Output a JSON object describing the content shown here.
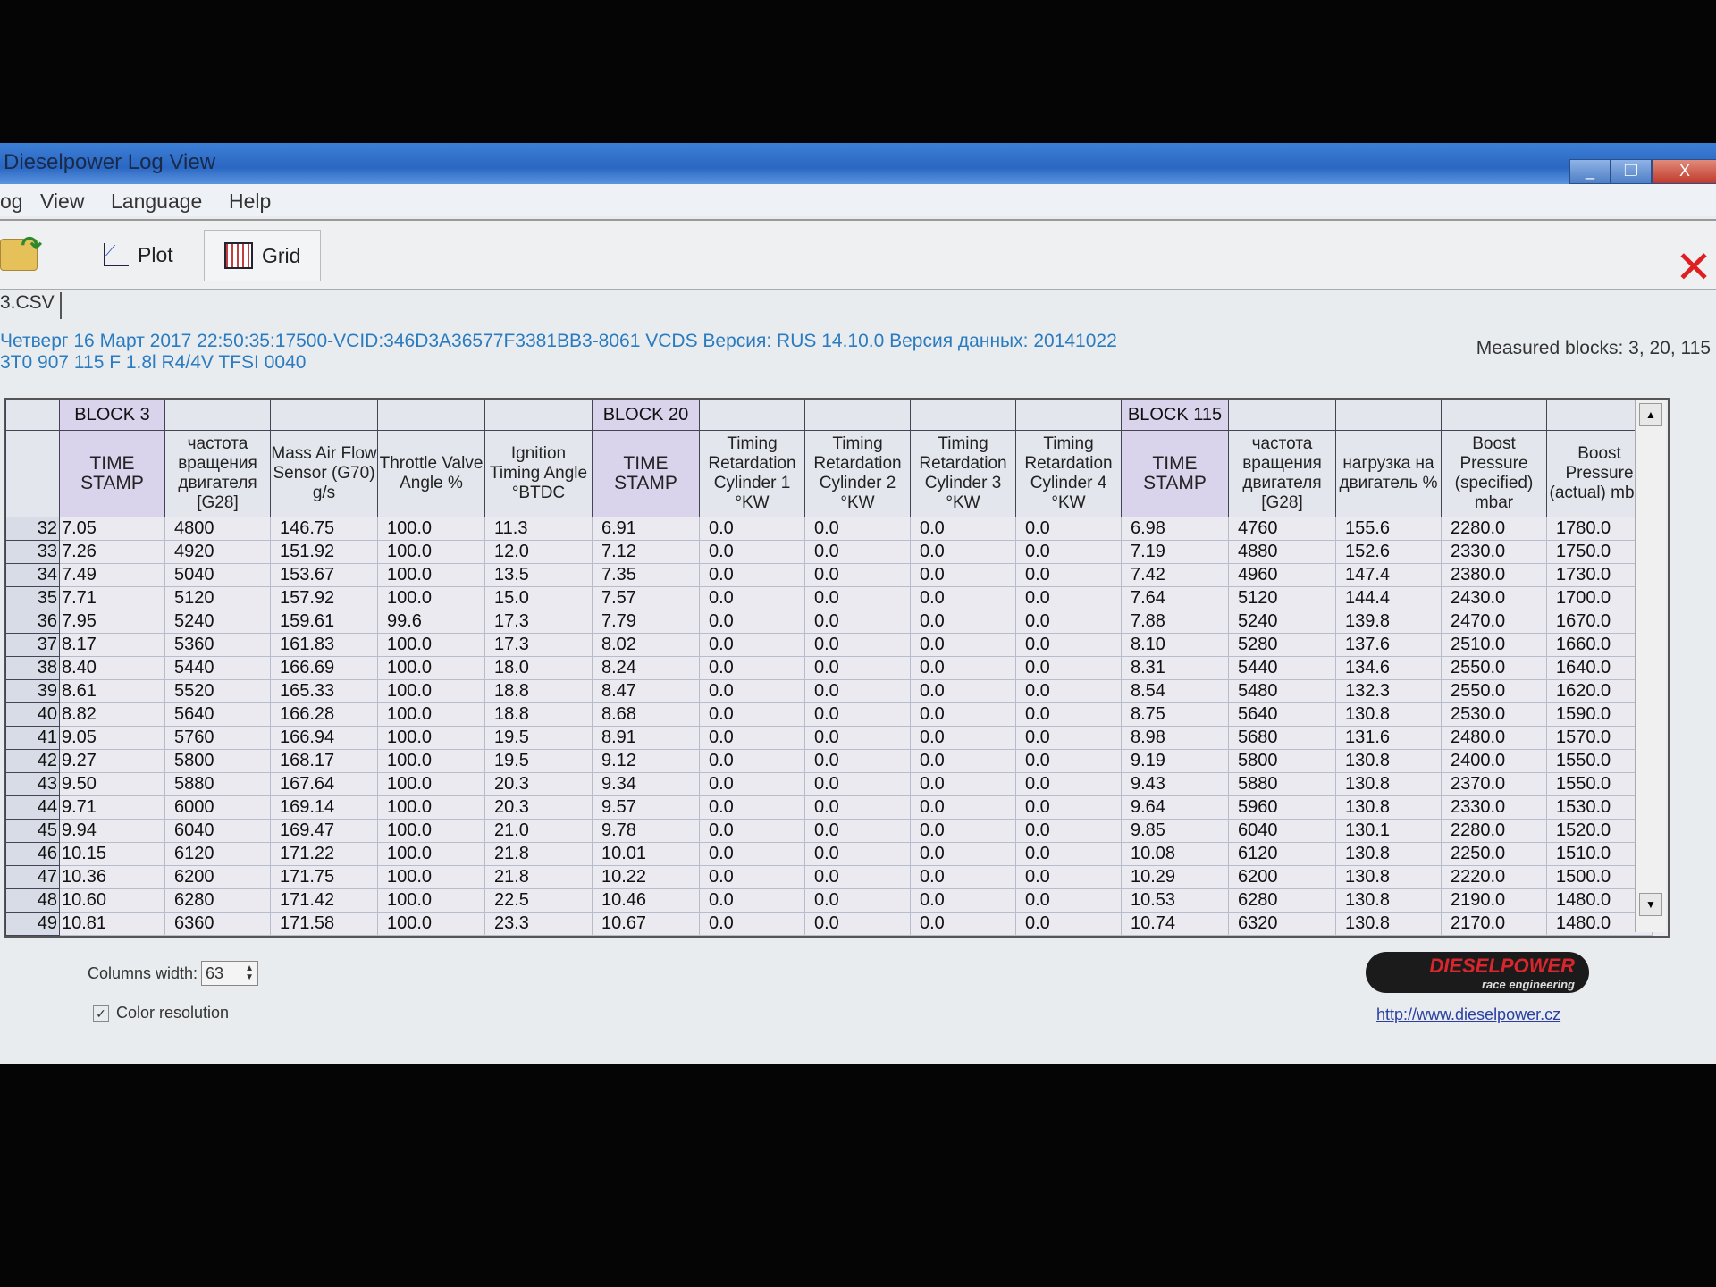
{
  "window": {
    "title": "Dieselpower Log View",
    "minimize": "_",
    "restore": "❐",
    "close": "X"
  },
  "menu": [
    "og",
    "View",
    "Language",
    "Help"
  ],
  "toolbar": {
    "plot": "Plot",
    "grid": "Grid",
    "close_icon": "✕"
  },
  "tab": {
    "label": "3.CSV"
  },
  "info": {
    "line1": "Четверг 16 Март 2017 22:50:35:17500-VCID:346D3A36577F3381BB3-8061 VCDS Версия: RUS 14.10.0 Версия данных: 20141022",
    "line2": "3T0 907 115 F  1.8l R4/4V TFSI     0040",
    "measured": "Measured blocks: 3, 20, 115"
  },
  "blocks": [
    "BLOCK 3",
    "BLOCK 20",
    "BLOCK 115"
  ],
  "columns": [
    "TIME STAMP",
    "частота вращения двигателя [G28]",
    "Mass Air Flow Sensor (G70) g/s",
    "Throttle Valve Angle %",
    "Ignition Timing Angle °BTDC",
    "TIME STAMP",
    "Timing Retardation Cylinder 1 °KW",
    "Timing Retardation Cylinder 2 °KW",
    "Timing Retardation Cylinder 3 °KW",
    "Timing Retardation Cylinder 4 °KW",
    "TIME STAMP",
    "частота вращения двигателя [G28]",
    "нагрузка на двигатель %",
    "Boost Pressure (specified) mbar",
    "Boost Pressure (actual) mbar"
  ],
  "rows": [
    [
      "32",
      "7.05",
      "4800",
      "146.75",
      "100.0",
      "11.3",
      "6.91",
      "0.0",
      "0.0",
      "0.0",
      "0.0",
      "6.98",
      "4760",
      "155.6",
      "2280.0",
      "1780.0"
    ],
    [
      "33",
      "7.26",
      "4920",
      "151.92",
      "100.0",
      "12.0",
      "7.12",
      "0.0",
      "0.0",
      "0.0",
      "0.0",
      "7.19",
      "4880",
      "152.6",
      "2330.0",
      "1750.0"
    ],
    [
      "34",
      "7.49",
      "5040",
      "153.67",
      "100.0",
      "13.5",
      "7.35",
      "0.0",
      "0.0",
      "0.0",
      "0.0",
      "7.42",
      "4960",
      "147.4",
      "2380.0",
      "1730.0"
    ],
    [
      "35",
      "7.71",
      "5120",
      "157.92",
      "100.0",
      "15.0",
      "7.57",
      "0.0",
      "0.0",
      "0.0",
      "0.0",
      "7.64",
      "5120",
      "144.4",
      "2430.0",
      "1700.0"
    ],
    [
      "36",
      "7.95",
      "5240",
      "159.61",
      "99.6",
      "17.3",
      "7.79",
      "0.0",
      "0.0",
      "0.0",
      "0.0",
      "7.88",
      "5240",
      "139.8",
      "2470.0",
      "1670.0"
    ],
    [
      "37",
      "8.17",
      "5360",
      "161.83",
      "100.0",
      "17.3",
      "8.02",
      "0.0",
      "0.0",
      "0.0",
      "0.0",
      "8.10",
      "5280",
      "137.6",
      "2510.0",
      "1660.0"
    ],
    [
      "38",
      "8.40",
      "5440",
      "166.69",
      "100.0",
      "18.0",
      "8.24",
      "0.0",
      "0.0",
      "0.0",
      "0.0",
      "8.31",
      "5440",
      "134.6",
      "2550.0",
      "1640.0"
    ],
    [
      "39",
      "8.61",
      "5520",
      "165.33",
      "100.0",
      "18.8",
      "8.47",
      "0.0",
      "0.0",
      "0.0",
      "0.0",
      "8.54",
      "5480",
      "132.3",
      "2550.0",
      "1620.0"
    ],
    [
      "40",
      "8.82",
      "5640",
      "166.28",
      "100.0",
      "18.8",
      "8.68",
      "0.0",
      "0.0",
      "0.0",
      "0.0",
      "8.75",
      "5640",
      "130.8",
      "2530.0",
      "1590.0"
    ],
    [
      "41",
      "9.05",
      "5760",
      "166.94",
      "100.0",
      "19.5",
      "8.91",
      "0.0",
      "0.0",
      "0.0",
      "0.0",
      "8.98",
      "5680",
      "131.6",
      "2480.0",
      "1570.0"
    ],
    [
      "42",
      "9.27",
      "5800",
      "168.17",
      "100.0",
      "19.5",
      "9.12",
      "0.0",
      "0.0",
      "0.0",
      "0.0",
      "9.19",
      "5800",
      "130.8",
      "2400.0",
      "1550.0"
    ],
    [
      "43",
      "9.50",
      "5880",
      "167.64",
      "100.0",
      "20.3",
      "9.34",
      "0.0",
      "0.0",
      "0.0",
      "0.0",
      "9.43",
      "5880",
      "130.8",
      "2370.0",
      "1550.0"
    ],
    [
      "44",
      "9.71",
      "6000",
      "169.14",
      "100.0",
      "20.3",
      "9.57",
      "0.0",
      "0.0",
      "0.0",
      "0.0",
      "9.64",
      "5960",
      "130.8",
      "2330.0",
      "1530.0"
    ],
    [
      "45",
      "9.94",
      "6040",
      "169.47",
      "100.0",
      "21.0",
      "9.78",
      "0.0",
      "0.0",
      "0.0",
      "0.0",
      "9.85",
      "6040",
      "130.1",
      "2280.0",
      "1520.0"
    ],
    [
      "46",
      "10.15",
      "6120",
      "171.22",
      "100.0",
      "21.8",
      "10.01",
      "0.0",
      "0.0",
      "0.0",
      "0.0",
      "10.08",
      "6120",
      "130.8",
      "2250.0",
      "1510.0"
    ],
    [
      "47",
      "10.36",
      "6200",
      "171.75",
      "100.0",
      "21.8",
      "10.22",
      "0.0",
      "0.0",
      "0.0",
      "0.0",
      "10.29",
      "6200",
      "130.8",
      "2220.0",
      "1500.0"
    ],
    [
      "48",
      "10.60",
      "6280",
      "171.42",
      "100.0",
      "22.5",
      "10.46",
      "0.0",
      "0.0",
      "0.0",
      "0.0",
      "10.53",
      "6280",
      "130.8",
      "2190.0",
      "1480.0"
    ],
    [
      "49",
      "10.81",
      "6360",
      "171.58",
      "100.0",
      "23.3",
      "10.67",
      "0.0",
      "0.0",
      "0.0",
      "0.0",
      "10.74",
      "6320",
      "130.8",
      "2170.0",
      "1480.0"
    ]
  ],
  "bottom": {
    "columns_width_label": "Columns width:",
    "columns_width_value": "63",
    "color_resolution_label": "Color resolution",
    "color_resolution_checked": true,
    "logo_text": "DIESELPOWER",
    "logo_sub": "race engineering",
    "link": "http://www.dieselpower.cz"
  },
  "colors": {
    "accent": "#2a67c2",
    "timestamp_col": "#d9d3ec",
    "info_text": "#2a7bc0",
    "close_red": "#e02020"
  }
}
